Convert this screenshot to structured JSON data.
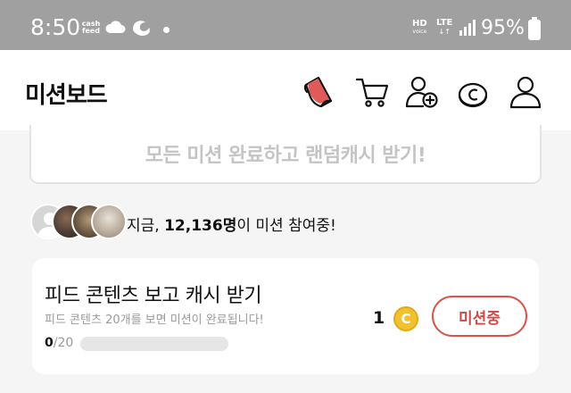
{
  "statusbar": {
    "time": "8:50",
    "cashfeed_line1": "cash",
    "cashfeed_line2": "feed",
    "network_hd": "HD",
    "network_hd_sub": "voice",
    "network_lte": "LTE",
    "network_lte_sub": "↓↑",
    "battery": "95%"
  },
  "header": {
    "title": "미션보드",
    "icons": [
      "sticker-icon",
      "cart-icon",
      "add-friend-icon",
      "cash-coin-icon",
      "profile-icon"
    ]
  },
  "banner": {
    "text": "모든 미션 완료하고 랜덤캐시 받기!"
  },
  "participants": {
    "prefix": "지금, ",
    "count": "12,136명",
    "suffix": "이 미션 참여중!"
  },
  "mission": {
    "title": "피드 콘텐츠 보고 캐시 받기",
    "description": "피드 콘텐츠 20개를 보면 미션이 완료됩니다!",
    "progress_current": "0",
    "progress_total": "/20",
    "progress_fraction": 0,
    "reward": "1",
    "coin_symbol": "C",
    "button_label": "미션중"
  },
  "colors": {
    "accent": "#d9534f",
    "coin": "#f2c12e",
    "statusbar": "#a0a0a0"
  }
}
